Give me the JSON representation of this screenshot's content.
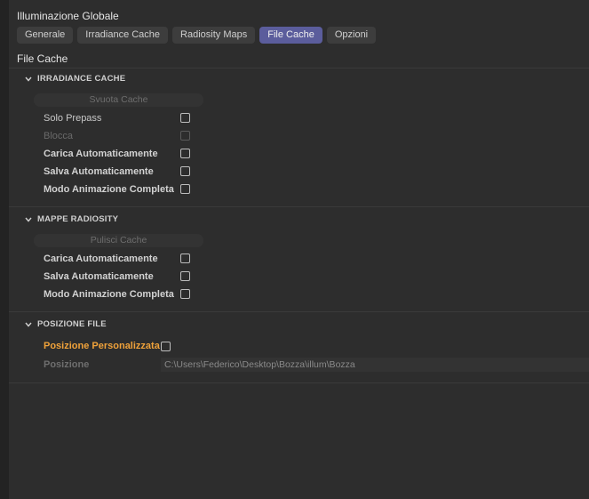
{
  "window": {
    "title": "Illuminazione Globale"
  },
  "tabs": [
    {
      "label": "Generale"
    },
    {
      "label": "Irradiance Cache"
    },
    {
      "label": "Radiosity Maps"
    },
    {
      "label": "File Cache"
    },
    {
      "label": "Opzioni"
    }
  ],
  "page": {
    "title": "File Cache"
  },
  "sections": {
    "irradiance": {
      "title": "IRRADIANCE CACHE",
      "button": "Svuota Cache",
      "rows": [
        {
          "label": "Solo Prepass",
          "checked": false
        },
        {
          "label": "Blocca",
          "checked": false
        },
        {
          "label": "Carica Automaticamente",
          "checked": false
        },
        {
          "label": "Salva Automaticamente",
          "checked": false
        },
        {
          "label": "Modo Animazione Completa",
          "checked": false
        }
      ]
    },
    "radiosity": {
      "title": "MAPPE RADIOSITY",
      "button": "Pulisci Cache",
      "rows": [
        {
          "label": "Carica Automaticamente",
          "checked": false
        },
        {
          "label": "Salva Automaticamente",
          "checked": false
        },
        {
          "label": "Modo Animazione Completa",
          "checked": false
        }
      ]
    },
    "filepos": {
      "title": "POSIZIONE FILE",
      "custom_label": "Posizione Personalizzata",
      "custom_checked": false,
      "path_label": "Posizione",
      "path_value": "C:\\Users\\Federico\\Desktop\\Bozza\\illum\\Bozza"
    }
  },
  "colors": {
    "accent_tab": "#5b5d9c",
    "highlight": "#f0a23a"
  }
}
